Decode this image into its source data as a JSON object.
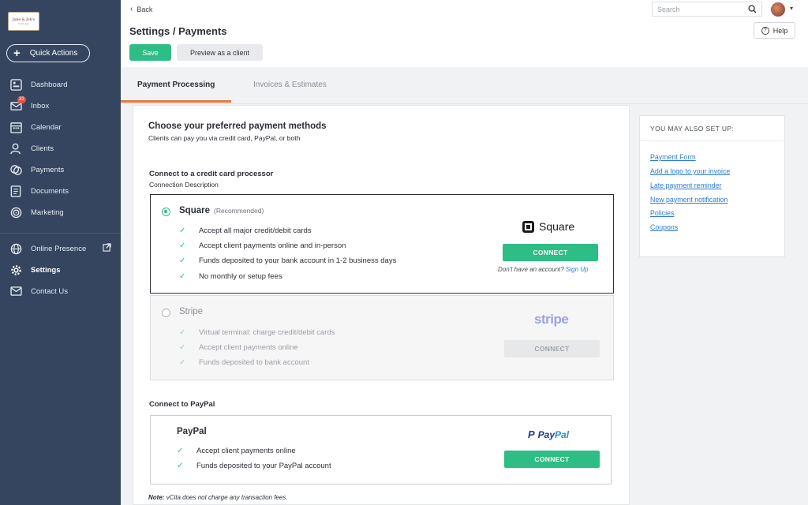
{
  "logo": {
    "line1": "June & Joh's",
    "line2": "New Age"
  },
  "quick_actions": "Quick Actions",
  "nav": {
    "dashboard": "Dashboard",
    "inbox": "Inbox",
    "inbox_badge": "32",
    "calendar": "Calendar",
    "clients": "Clients",
    "payments": "Payments",
    "documents": "Documents",
    "marketing": "Marketing",
    "online_presence": "Online Presence",
    "settings": "Settings",
    "contact_us": "Contact Us"
  },
  "topbar": {
    "back": "Back",
    "search_placeholder": "Search",
    "help": "Help"
  },
  "page": {
    "title": "Settings / Payments",
    "save": "Save",
    "preview": "Preview as a client"
  },
  "tabs": [
    "Payment Processing",
    "Invoices & Estimates"
  ],
  "main": {
    "title": "Choose your preferred payment methods",
    "subtitle": "Clients can pay you via credit card, PayPal, or both",
    "cc_title": "Connect to a credit card processor",
    "cc_desc": "Connection Description",
    "square": {
      "name": "Square",
      "recommended": "(Recommended)",
      "features": [
        "Accept all major credit/debit cards",
        "Accept client payments online and in-person",
        "Funds deposited to your bank account in 1-2 business days",
        "No monthly or setup fees"
      ],
      "logo_text": "Square",
      "connect": "CONNECT",
      "no_account": "Don't have an account?",
      "sign_up": "Sign Up"
    },
    "stripe": {
      "name": "Stripe",
      "features": [
        "Virtual terminal: charge credit/debit cards",
        "Accept client payments online",
        "Funds deposited to bank account"
      ],
      "logo_text": "stripe",
      "connect": "CONNECT"
    },
    "paypal_title": "Connect to PayPal",
    "paypal": {
      "name": "PayPal",
      "features": [
        "Accept client payments online",
        "Funds deposited to your PayPal account"
      ],
      "logo_pay": "Pay",
      "logo_pal": "Pal",
      "connect": "CONNECT"
    },
    "note_label": "Note:",
    "note_text": "vCita does not charge any transaction fees."
  },
  "side_panel": {
    "heading": "YOU MAY ALSO SET UP:",
    "links": [
      "Payment Form",
      "Add a logo to your invoice",
      "Late payment reminder",
      "New payment notification",
      "Policies",
      "Coupons"
    ]
  }
}
